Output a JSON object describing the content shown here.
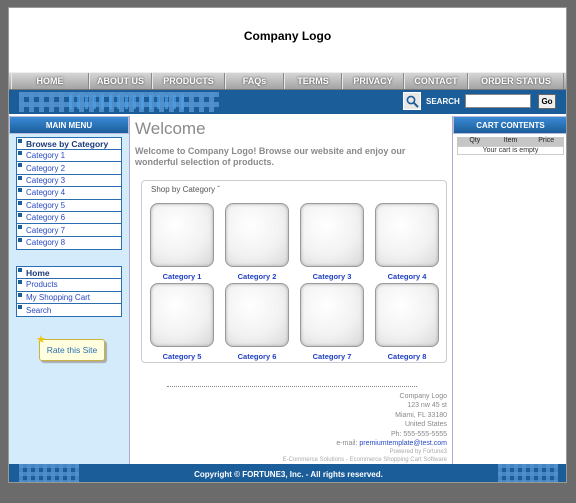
{
  "header": {
    "logo": "Company Logo"
  },
  "topnav": [
    {
      "label": "HOME"
    },
    {
      "label": "ABOUT US"
    },
    {
      "label": "PRODUCTS"
    },
    {
      "label": "FAQs"
    },
    {
      "label": "TERMS"
    },
    {
      "label": "PRIVACY"
    },
    {
      "label": "CONTACT"
    },
    {
      "label": "ORDER STATUS"
    }
  ],
  "search": {
    "label": "SEARCH",
    "placeholder": "",
    "go": "Go"
  },
  "left": {
    "title": "MAIN MENU",
    "browse_title": "Browse by Category",
    "categories": [
      "Category 1",
      "Category 2",
      "Category 3",
      "Category 4",
      "Category 5",
      "Category 6",
      "Category 7",
      "Category 8"
    ],
    "home_title": "Home",
    "links": [
      "Products",
      "My Shopping Cart",
      "Search"
    ],
    "rate": "Rate this Site"
  },
  "main": {
    "title": "Welcome",
    "intro": "Welcome to  Company Logo! Browse our website and enjoy our wonderful selection of products.",
    "shop_title": "Shop by Category ˇ",
    "categories": [
      "Category 1",
      "Category 2",
      "Category 3",
      "Category 4",
      "Category 5",
      "Category 6",
      "Category 7",
      "Category 8"
    ]
  },
  "address": {
    "company": "Company Logo",
    "street": "123 nw 45 st",
    "city": "Miami, FL 33180",
    "country": "United States",
    "phone": "Ph: 555-555-5555",
    "email_prefix": "e-mail: ",
    "email": "premiumtemplate@test.com",
    "powered": "Powered by Fortune3",
    "tagline": "E-Commerce Solutions - Ecommerce Shopping Cart Software"
  },
  "cart": {
    "title": "CART CONTENTS",
    "cols": [
      "Qty",
      "Item",
      "Price"
    ],
    "empty": "Your cart is empty"
  },
  "footer": {
    "text": "Copyright © FORTUNE3, Inc. - All rights reserved."
  },
  "colors": {
    "brand_blue": "#1b5d99",
    "link_blue": "#2a4ac4",
    "panel_bg": "#d3ebfa"
  }
}
